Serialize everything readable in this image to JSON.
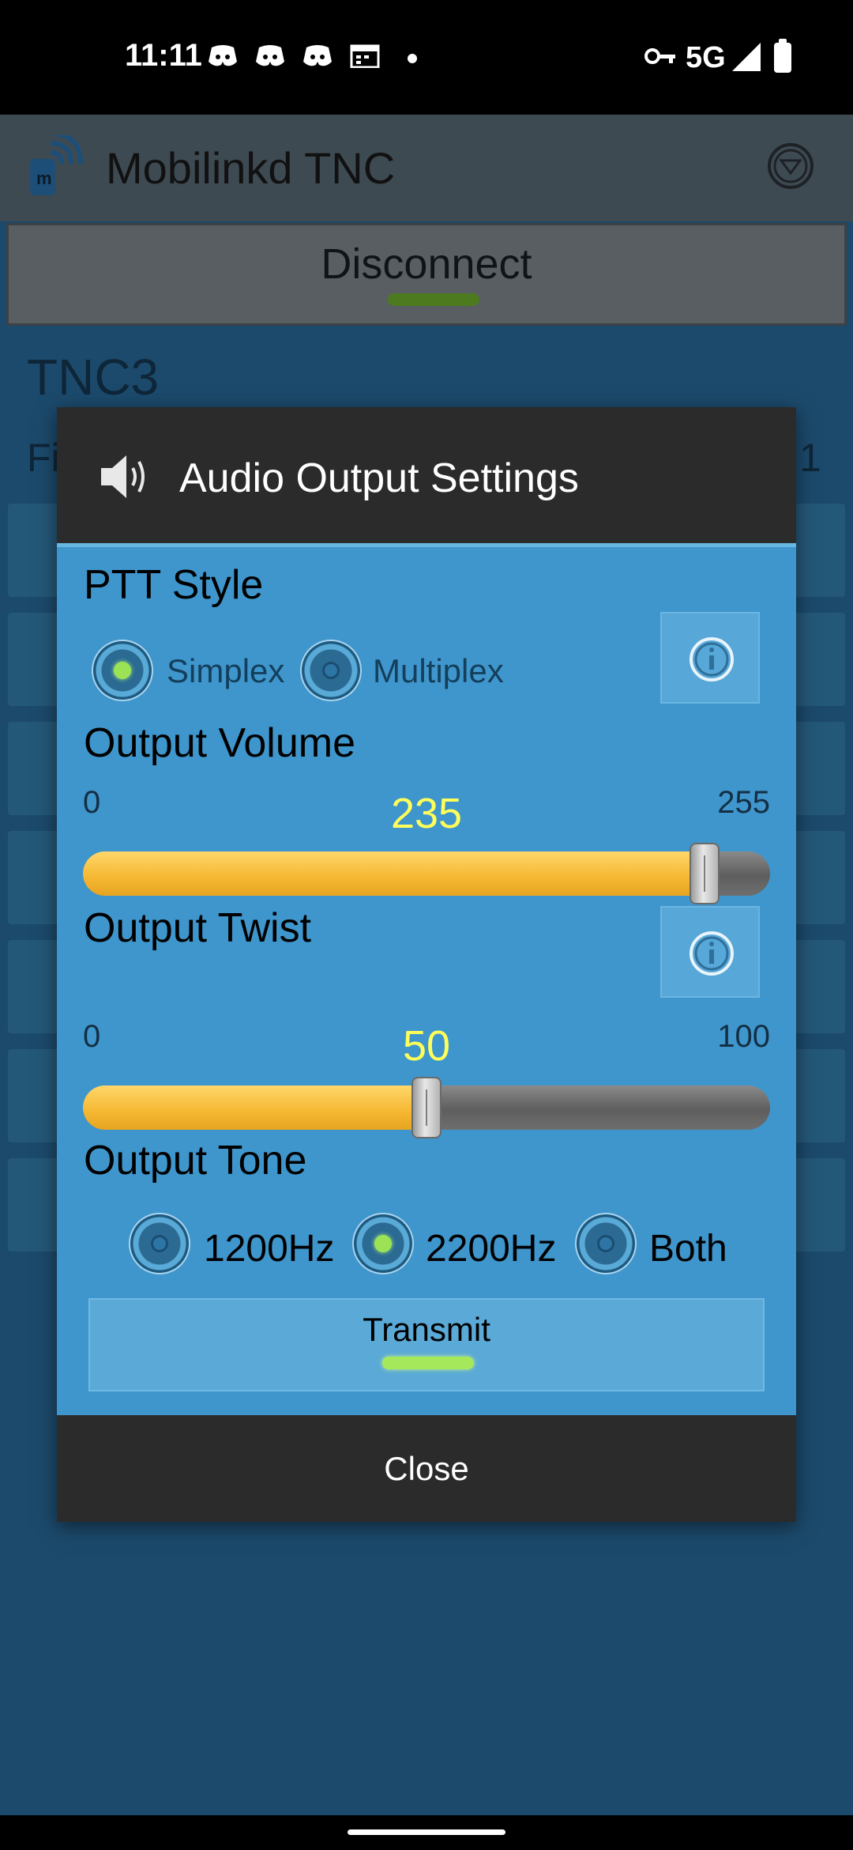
{
  "status_bar": {
    "time": "11:11",
    "network": "5G",
    "icons": [
      "discord-icon",
      "discord-icon",
      "discord-icon",
      "calendar-icon",
      "dot-icon",
      "vpn-key-icon",
      "signal-icon",
      "battery-icon"
    ]
  },
  "app_bar": {
    "title": "Mobilinkd TNC",
    "icon": "mobilinkd-logo-icon",
    "menu_icon": "dropdown-circle-icon"
  },
  "connection": {
    "disconnect_label": "Disconnect",
    "indicator_color": "#4d7a1e"
  },
  "background": {
    "device_name": "TNC3",
    "left_fragment": "Fi",
    "right_fragment": "1"
  },
  "dialog": {
    "title": "Audio Output Settings",
    "title_icon": "speaker-icon",
    "ptt_style": {
      "label": "PTT Style",
      "options": [
        {
          "label": "Simplex",
          "selected": true
        },
        {
          "label": "Multiplex",
          "selected": false
        }
      ],
      "info_icon": "info-icon"
    },
    "output_volume": {
      "label": "Output Volume",
      "min": "0",
      "max": "255",
      "value": "235",
      "value_number": 235,
      "max_number": 255
    },
    "output_twist": {
      "label": "Output Twist",
      "info_icon": "info-icon",
      "min": "0",
      "max": "100",
      "value": "50",
      "value_number": 50,
      "max_number": 100
    },
    "output_tone": {
      "label": "Output Tone",
      "options": [
        {
          "label": "1200Hz",
          "selected": false
        },
        {
          "label": "2200Hz",
          "selected": true
        },
        {
          "label": "Both",
          "selected": false
        }
      ]
    },
    "transmit_label": "Transmit",
    "close_label": "Close"
  },
  "colors": {
    "accent_fill": "#f5b732",
    "dialog_body": "#3f96cc",
    "value_text": "#ffff5a",
    "radio_selected": "#9be354"
  }
}
